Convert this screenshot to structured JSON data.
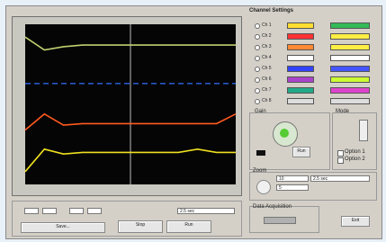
{
  "window": {
    "title": "Channel Settings"
  },
  "channels": [
    {
      "label": "Ch 1",
      "left": "#ffdd33",
      "right": "#33bb55"
    },
    {
      "label": "Ch 2",
      "left": "#ff3333",
      "right": "#ffee44"
    },
    {
      "label": "Ch 3",
      "left": "#ff8833",
      "right": "#ffee44"
    },
    {
      "label": "Ch 4",
      "left": "#ffffff",
      "right": "#ffffff"
    },
    {
      "label": "Ch 5",
      "left": "#3344ff",
      "right": "#4455ff"
    },
    {
      "label": "Ch 6",
      "left": "#aa44cc",
      "right": "#ccff33"
    },
    {
      "label": "Ch 7",
      "left": "#22aa88",
      "right": "#dd44cc"
    },
    {
      "label": "Ch 8",
      "left": "#dddddd",
      "right": "#dddddd"
    }
  ],
  "chart_data": {
    "type": "line",
    "series": [
      {
        "color": "#c0d070",
        "values": [
          0.92,
          0.84,
          0.86,
          0.87,
          0.87,
          0.87,
          0.87,
          0.87,
          0.87,
          0.87,
          0.87,
          0.87
        ]
      },
      {
        "color": "#3070ff",
        "values": [
          0.63,
          0.63,
          0.63,
          0.63,
          0.63,
          0.63,
          0.63,
          0.63,
          0.63,
          0.63,
          0.63,
          0.63
        ]
      },
      {
        "color": "#ff5a20",
        "values": [
          0.34,
          0.44,
          0.37,
          0.38,
          0.38,
          0.38,
          0.38,
          0.38,
          0.38,
          0.38,
          0.38,
          0.44
        ]
      },
      {
        "color": "#f0e020",
        "values": [
          0.08,
          0.22,
          0.19,
          0.2,
          0.2,
          0.2,
          0.2,
          0.2,
          0.2,
          0.22,
          0.2,
          0.2
        ]
      }
    ]
  },
  "controls": {
    "panel_title": "Data Acquisition",
    "gain_label": "Gain",
    "mode_label": "Mode",
    "run_label": "Run",
    "stop_label": "Stop",
    "save_label": "Save...",
    "zoom_label": "Zoom",
    "option1": "Option 1",
    "option2": "Option 2",
    "field_a": "10",
    "field_b": "5",
    "time_value": "2.5 sec",
    "exit_label": "Exit"
  }
}
